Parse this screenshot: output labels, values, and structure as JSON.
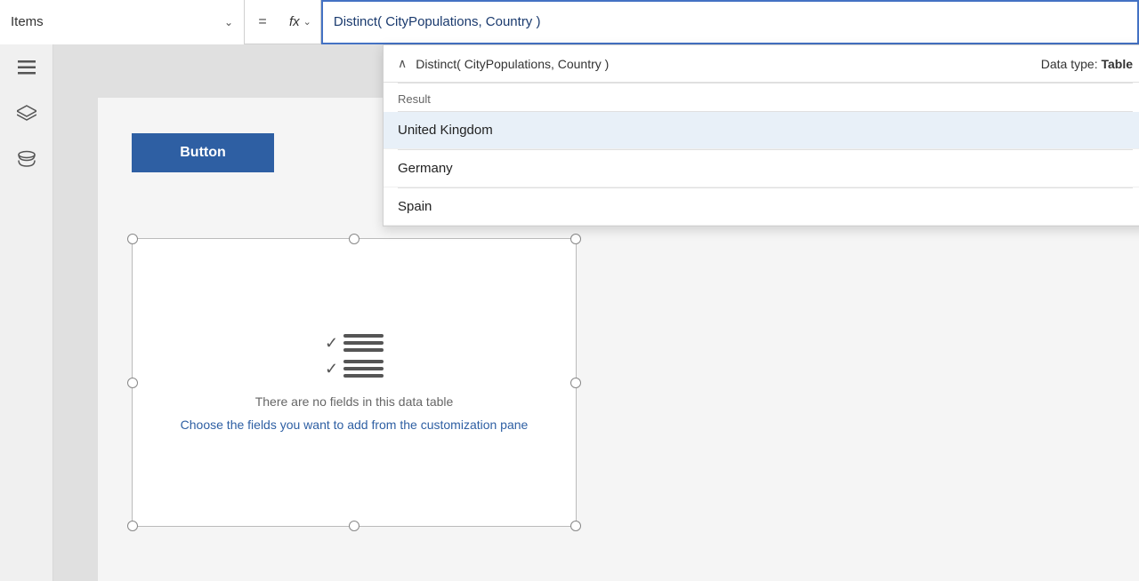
{
  "topbar": {
    "items_label": "Items",
    "chevron": "⌄",
    "equals": "=",
    "fx": "fx",
    "formula": "Distinct( CityPopulations, Country )"
  },
  "dropdown": {
    "title": "Distinct( CityPopulations, Country )",
    "datatype_label": "Data type: ",
    "datatype_value": "Table",
    "section_header": "Result",
    "items": [
      {
        "label": "United Kingdom"
      },
      {
        "label": "Germany"
      },
      {
        "label": "Spain"
      }
    ]
  },
  "sidebar": {
    "icons": [
      {
        "name": "hamburger-menu",
        "symbol": "≡"
      },
      {
        "name": "layers-icon",
        "symbol": "⊞"
      },
      {
        "name": "database-icon",
        "symbol": "⬡"
      }
    ]
  },
  "canvas": {
    "button_label": "Button",
    "gallery_empty": "There are no fields in this data table",
    "gallery_link": "Choose the fields you want to add from the customization pane"
  }
}
